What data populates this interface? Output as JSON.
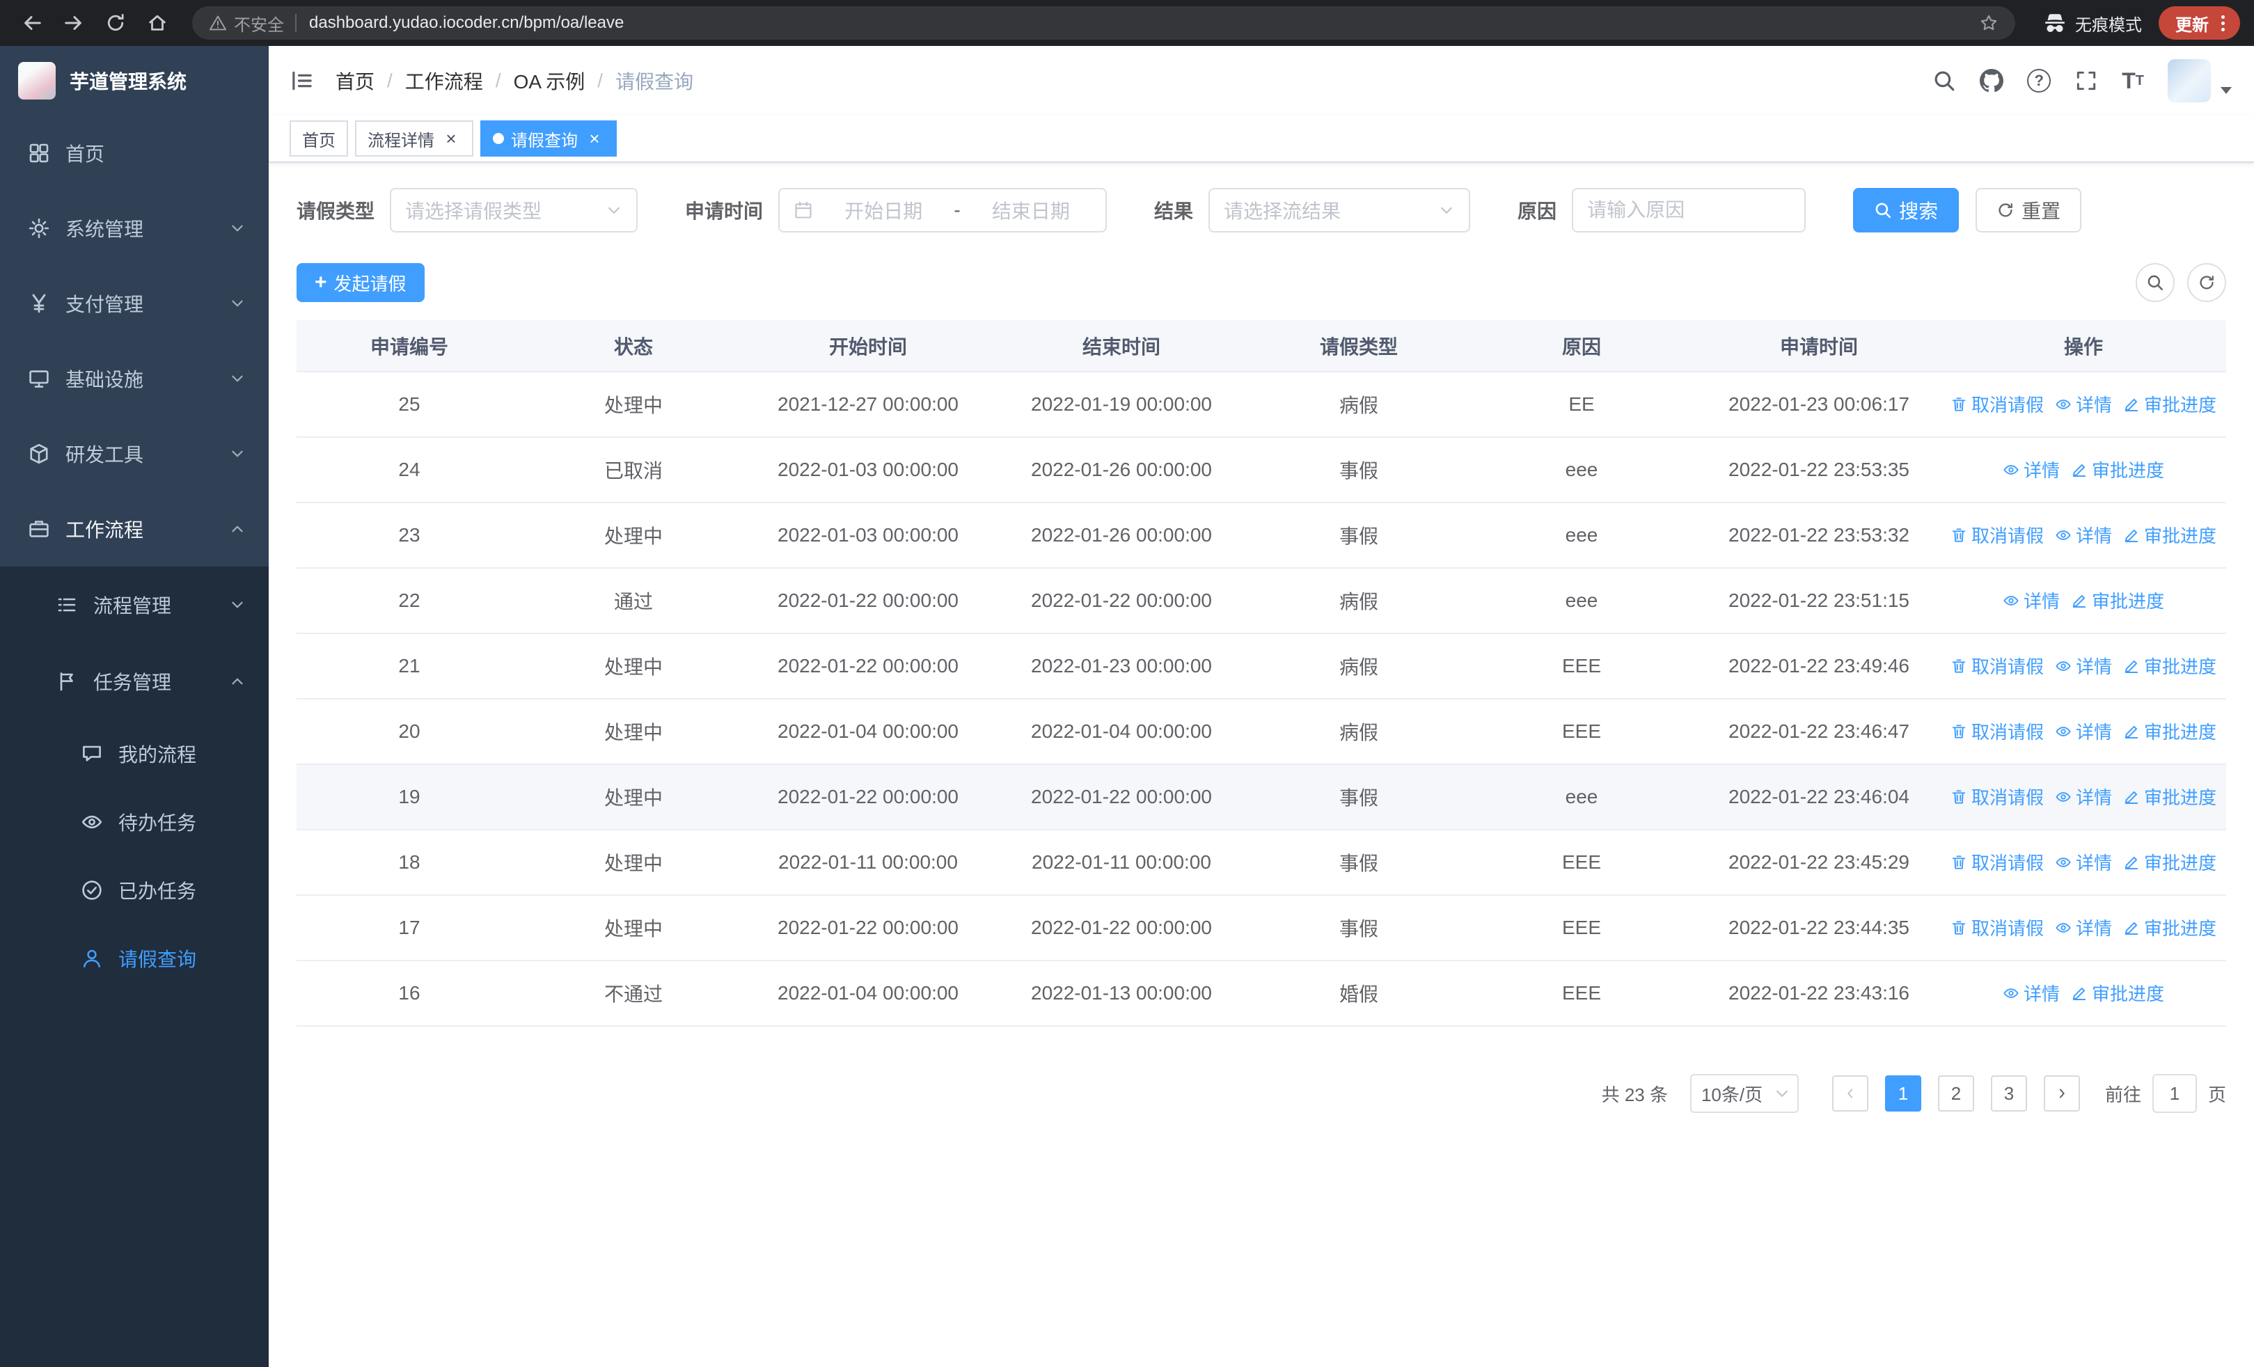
{
  "browser": {
    "security_label": "不安全",
    "url": "dashboard.yudao.iocoder.cn/bpm/oa/leave",
    "incognito_label": "无痕模式",
    "update_label": "更新"
  },
  "sidebar": {
    "logo_title": "芋道管理系统",
    "menu": [
      {
        "key": "home",
        "label": "首页",
        "icon": "home",
        "level": 1
      },
      {
        "key": "system-mgmt",
        "label": "系统管理",
        "icon": "gear",
        "level": 1,
        "arrow": "down"
      },
      {
        "key": "payment-mgmt",
        "label": "支付管理",
        "icon": "yen",
        "level": 1,
        "arrow": "down"
      },
      {
        "key": "infrastructure",
        "label": "基础设施",
        "icon": "infra",
        "level": 1,
        "arrow": "down"
      },
      {
        "key": "dev-tools",
        "label": "研发工具",
        "icon": "tools",
        "level": 1,
        "arrow": "down"
      },
      {
        "key": "workflow",
        "label": "工作流程",
        "icon": "workflow",
        "level": 1,
        "arrow": "up",
        "open": true
      },
      {
        "key": "process-mgmt",
        "label": "流程管理",
        "icon": "list",
        "level": 2,
        "arrow": "down"
      },
      {
        "key": "task-mgmt",
        "label": "任务管理",
        "icon": "task",
        "level": 2,
        "arrow": "up",
        "open": true
      },
      {
        "key": "my-process",
        "label": "我的流程",
        "icon": "chat",
        "level": 3
      },
      {
        "key": "todo-tasks",
        "label": "待办任务",
        "icon": "eye",
        "level": 3
      },
      {
        "key": "done-tasks",
        "label": "已办任务",
        "icon": "done",
        "level": 3
      },
      {
        "key": "leave-query",
        "label": "请假查询",
        "icon": "user",
        "level": 3,
        "active": true
      }
    ]
  },
  "header": {
    "breadcrumb": [
      "首页",
      "工作流程",
      "OA 示例",
      "请假查询"
    ]
  },
  "tabs": [
    {
      "label": "首页",
      "closable": false,
      "active": false
    },
    {
      "label": "流程详情",
      "closable": true,
      "active": false
    },
    {
      "label": "请假查询",
      "closable": true,
      "active": true
    }
  ],
  "filters": {
    "leave_type_label": "请假类型",
    "leave_type_placeholder": "请选择请假类型",
    "apply_time_label": "申请时间",
    "start_date_placeholder": "开始日期",
    "range_separator": "-",
    "end_date_placeholder": "结束日期",
    "result_label": "结果",
    "result_placeholder": "请选择流结果",
    "reason_label": "原因",
    "reason_placeholder": "请输入原因",
    "search_button": "搜索",
    "reset_button": "重置"
  },
  "toolbar": {
    "create_button": "发起请假"
  },
  "table": {
    "columns": [
      "申请编号",
      "状态",
      "开始时间",
      "结束时间",
      "请假类型",
      "原因",
      "申请时间",
      "操作"
    ],
    "actions": {
      "cancel": "取消请假",
      "detail": "详情",
      "progress": "审批进度"
    },
    "rows": [
      {
        "id": "25",
        "status": "处理中",
        "start": "2021-12-27 00:00:00",
        "end": "2022-01-19 00:00:00",
        "type": "病假",
        "reason": "EE",
        "applied": "2022-01-23 00:06:17",
        "cancellable": true,
        "highlighted": false
      },
      {
        "id": "24",
        "status": "已取消",
        "start": "2022-01-03 00:00:00",
        "end": "2022-01-26 00:00:00",
        "type": "事假",
        "reason": "eee",
        "applied": "2022-01-22 23:53:35",
        "cancellable": false,
        "highlighted": false
      },
      {
        "id": "23",
        "status": "处理中",
        "start": "2022-01-03 00:00:00",
        "end": "2022-01-26 00:00:00",
        "type": "事假",
        "reason": "eee",
        "applied": "2022-01-22 23:53:32",
        "cancellable": true,
        "highlighted": false
      },
      {
        "id": "22",
        "status": "通过",
        "start": "2022-01-22 00:00:00",
        "end": "2022-01-22 00:00:00",
        "type": "病假",
        "reason": "eee",
        "applied": "2022-01-22 23:51:15",
        "cancellable": false,
        "highlighted": false
      },
      {
        "id": "21",
        "status": "处理中",
        "start": "2022-01-22 00:00:00",
        "end": "2022-01-23 00:00:00",
        "type": "病假",
        "reason": "EEE",
        "applied": "2022-01-22 23:49:46",
        "cancellable": true,
        "highlighted": false
      },
      {
        "id": "20",
        "status": "处理中",
        "start": "2022-01-04 00:00:00",
        "end": "2022-01-04 00:00:00",
        "type": "病假",
        "reason": "EEE",
        "applied": "2022-01-22 23:46:47",
        "cancellable": true,
        "highlighted": false
      },
      {
        "id": "19",
        "status": "处理中",
        "start": "2022-01-22 00:00:00",
        "end": "2022-01-22 00:00:00",
        "type": "事假",
        "reason": "eee",
        "applied": "2022-01-22 23:46:04",
        "cancellable": true,
        "highlighted": true
      },
      {
        "id": "18",
        "status": "处理中",
        "start": "2022-01-11 00:00:00",
        "end": "2022-01-11 00:00:00",
        "type": "事假",
        "reason": "EEE",
        "applied": "2022-01-22 23:45:29",
        "cancellable": true,
        "highlighted": false
      },
      {
        "id": "17",
        "status": "处理中",
        "start": "2022-01-22 00:00:00",
        "end": "2022-01-22 00:00:00",
        "type": "事假",
        "reason": "EEE",
        "applied": "2022-01-22 23:44:35",
        "cancellable": true,
        "highlighted": false
      },
      {
        "id": "16",
        "status": "不通过",
        "start": "2022-01-04 00:00:00",
        "end": "2022-01-13 00:00:00",
        "type": "婚假",
        "reason": "EEE",
        "applied": "2022-01-22 23:43:16",
        "cancellable": false,
        "highlighted": false
      }
    ]
  },
  "pagination": {
    "total_text": "共 23 条",
    "page_size": "10条/页",
    "pages": [
      "1",
      "2",
      "3"
    ],
    "active_page": "1",
    "goto_label": "前往",
    "goto_value": "1",
    "page_suffix": "页"
  },
  "colors": {
    "primary": "#409eff",
    "sidebar_bg": "#304156",
    "sidebar_sub_bg": "#1f2d3d"
  }
}
